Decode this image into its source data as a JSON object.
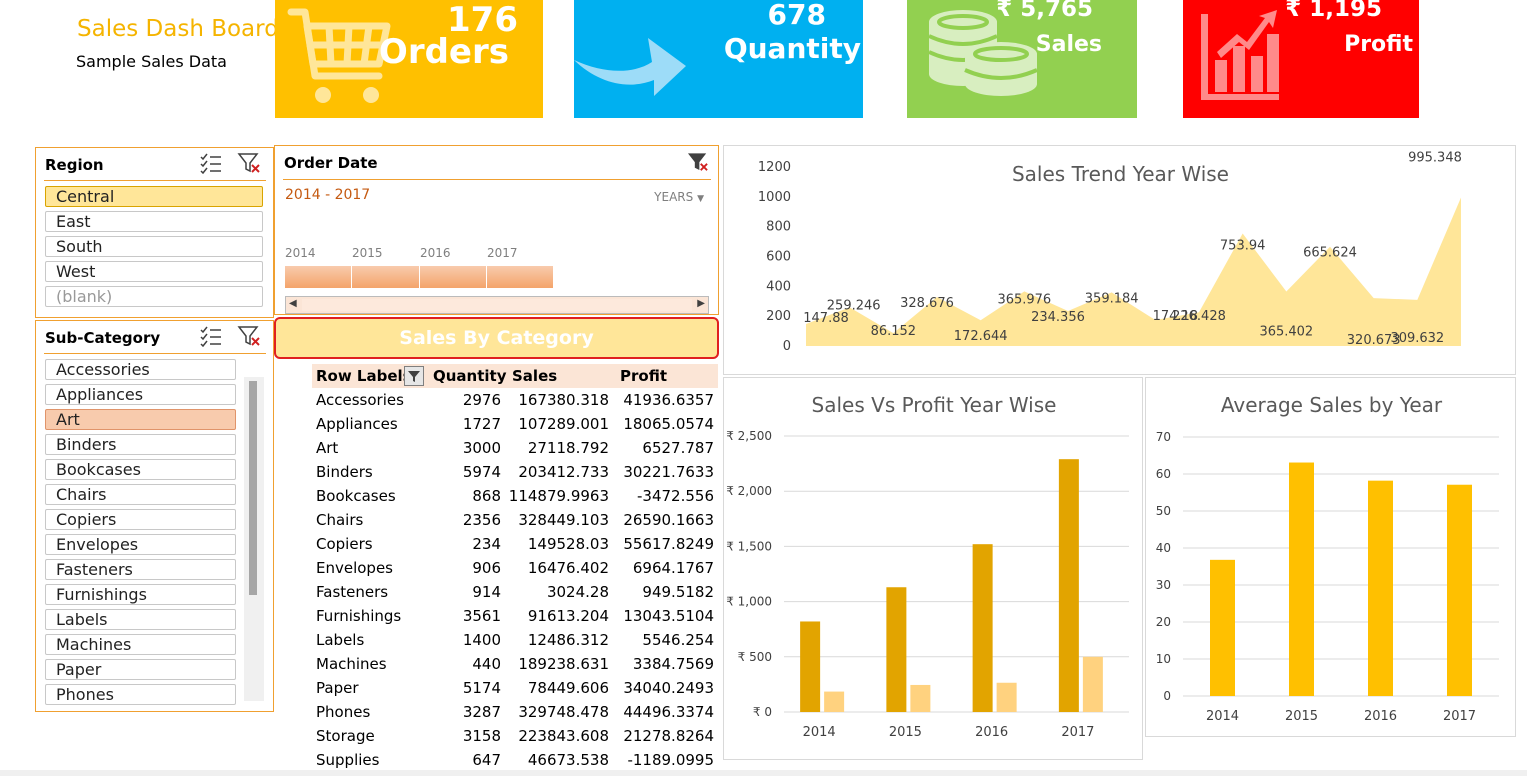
{
  "header": {
    "title": "Sales Dash Board",
    "subtitle": "Sample Sales Data"
  },
  "kpis": {
    "orders": {
      "value": "176",
      "label": "Orders",
      "color": "#ffc000",
      "icon": "shopping-cart-icon"
    },
    "quantity": {
      "value": "678",
      "label": "Quantity",
      "color": "#00b0f0",
      "icon": "arrow-icon"
    },
    "sales": {
      "value": "₹ 5,765",
      "label": "Sales",
      "color": "#92d050",
      "icon": "coins-icon"
    },
    "profit": {
      "value": "₹ 1,195",
      "label": "Profit",
      "color": "#ff0000",
      "icon": "growth-chart-icon"
    }
  },
  "region_slicer": {
    "title": "Region",
    "items": [
      {
        "label": "Central",
        "selected": true
      },
      {
        "label": "East",
        "selected": false
      },
      {
        "label": "South",
        "selected": false
      },
      {
        "label": "West",
        "selected": false
      },
      {
        "label": "(blank)",
        "selected": false
      }
    ]
  },
  "subcategory_slicer": {
    "title": "Sub-Category",
    "items": [
      {
        "label": "Accessories",
        "selected": false
      },
      {
        "label": "Appliances",
        "selected": false
      },
      {
        "label": "Art",
        "selected": true
      },
      {
        "label": "Binders",
        "selected": false
      },
      {
        "label": "Bookcases",
        "selected": false
      },
      {
        "label": "Chairs",
        "selected": false
      },
      {
        "label": "Copiers",
        "selected": false
      },
      {
        "label": "Envelopes",
        "selected": false
      },
      {
        "label": "Fasteners",
        "selected": false
      },
      {
        "label": "Furnishings",
        "selected": false
      },
      {
        "label": "Labels",
        "selected": false
      },
      {
        "label": "Machines",
        "selected": false
      },
      {
        "label": "Paper",
        "selected": false
      },
      {
        "label": "Phones",
        "selected": false
      }
    ]
  },
  "timeline": {
    "title": "Order Date",
    "range": "2014 - 2017",
    "level": "YEARS",
    "years": [
      "2014",
      "2015",
      "2016",
      "2017"
    ]
  },
  "category_panel": {
    "title": "Sales  By Category"
  },
  "pivot": {
    "headers": [
      "Row Labels",
      "Quantity",
      "Sales",
      "Profit"
    ],
    "rows": [
      [
        "Accessories",
        "2976",
        "167380.318",
        "41936.6357"
      ],
      [
        "Appliances",
        "1727",
        "107289.001",
        "18065.0574"
      ],
      [
        "Art",
        "3000",
        "27118.792",
        "6527.787"
      ],
      [
        "Binders",
        "5974",
        "203412.733",
        "30221.7633"
      ],
      [
        "Bookcases",
        "868",
        "114879.9963",
        "-3472.556"
      ],
      [
        "Chairs",
        "2356",
        "328449.103",
        "26590.1663"
      ],
      [
        "Copiers",
        "234",
        "149528.03",
        "55617.8249"
      ],
      [
        "Envelopes",
        "906",
        "16476.402",
        "6964.1767"
      ],
      [
        "Fasteners",
        "914",
        "3024.28",
        "949.5182"
      ],
      [
        "Furnishings",
        "3561",
        "91613.204",
        "13043.5104"
      ],
      [
        "Labels",
        "1400",
        "12486.312",
        "5546.254"
      ],
      [
        "Machines",
        "440",
        "189238.631",
        "3384.7569"
      ],
      [
        "Paper",
        "5174",
        "78449.606",
        "34040.2493"
      ],
      [
        "Phones",
        "3287",
        "329748.478",
        "44496.3374"
      ],
      [
        "Storage",
        "3158",
        "223843.608",
        "21278.8264"
      ],
      [
        "Supplies",
        "647",
        "46673.538",
        "-1189.0995"
      ]
    ]
  },
  "chart_data": [
    {
      "type": "area",
      "title": "Sales Trend Year Wise",
      "ylim": [
        0,
        1200
      ],
      "yticks": [
        "0",
        "200",
        "400",
        "600",
        "800",
        "1000",
        "1200"
      ],
      "values": [
        147.88,
        259.246,
        86.152,
        328.676,
        172.644,
        365.976,
        234.356,
        359.184,
        174.18,
        226.428,
        753.94,
        365.402,
        665.624,
        320.673,
        309.632,
        995.348
      ],
      "labels": [
        "147.88",
        "259.246",
        "86.152",
        "328.676",
        "172.644",
        "365.976",
        "234.356",
        "359.184",
        "174.18",
        "226.428",
        "753.94",
        "365.402",
        "665.624",
        "320.673",
        "309.632",
        "995.348"
      ],
      "color": "#ffe699"
    },
    {
      "type": "bar",
      "title": "Sales Vs Profit Year Wise",
      "categories": [
        "2014",
        "2015",
        "2016",
        "2017"
      ],
      "ylim": [
        0,
        2500
      ],
      "yticks": [
        "₹ 0",
        "₹ 500",
        "₹ 1,000",
        "₹ 1,500",
        "₹ 2,000",
        "₹ 2,500"
      ],
      "series": [
        {
          "values": [
            820,
            1130,
            1520,
            2290
          ],
          "color": "#e2a400"
        },
        {
          "values": [
            185,
            245,
            265,
            500
          ],
          "color": "#ffd27f"
        }
      ]
    },
    {
      "type": "bar",
      "title": "Average Sales by Year",
      "categories": [
        "2014",
        "2015",
        "2016",
        "2017"
      ],
      "ylim": [
        0,
        70
      ],
      "yticks": [
        "0",
        "10",
        "20",
        "30",
        "40",
        "50",
        "60",
        "70"
      ],
      "values": [
        36.8,
        63.1,
        58.2,
        57.1
      ],
      "color": "#ffc000"
    }
  ]
}
